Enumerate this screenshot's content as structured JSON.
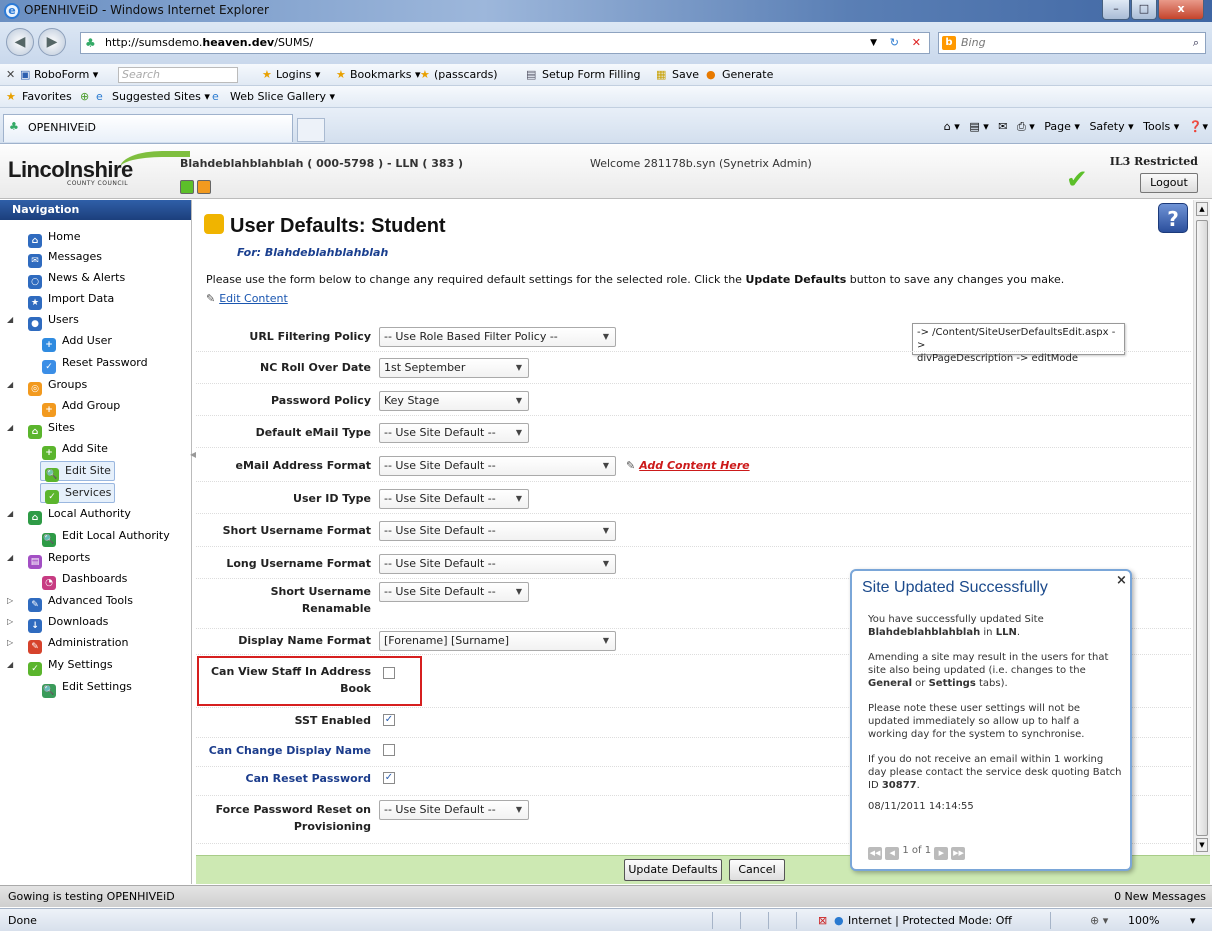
{
  "window": {
    "title": "OPENHIVEiD - Windows Internet Explorer",
    "min": "–",
    "max": "□",
    "close": "x"
  },
  "browser": {
    "url_prefix": "http://sumsdemo.",
    "url_host": "heaven.dev",
    "url_path": "/SUMS/",
    "search_placeholder": "Bing",
    "roboform": {
      "name": "RoboForm ▾",
      "search": "Search",
      "logins": "Logins ▾",
      "bookmarks": "Bookmarks ▾",
      "passcards": "(passcards)",
      "setup": "Setup Form Filling",
      "save": "Save",
      "generate": "Generate"
    },
    "favorites": {
      "label": "Favorites",
      "suggested": "Suggested Sites ▾",
      "webslice": "Web Slice Gallery ▾"
    },
    "tab_title": "OPENHIVEiD",
    "commands": [
      "Page ▾",
      "Safety ▾",
      "Tools ▾"
    ]
  },
  "header": {
    "logo": "Lincolnshire",
    "logo_sub": "COUNTY COUNCIL",
    "site_info": "Blahdeblahblahblah ( 000-5798 ) - LLN ( 383 )",
    "welcome": "Welcome 281178b.syn (Synetrix Admin)",
    "classification": "IL3 Restricted",
    "logout": "Logout"
  },
  "nav": {
    "title": "Navigation",
    "items": [
      {
        "label": "Home",
        "color": "#2f6bbf",
        "glyph": "⌂"
      },
      {
        "label": "Messages",
        "color": "#2f6bbf",
        "glyph": "✉"
      },
      {
        "label": "News & Alerts",
        "color": "#2f6bbf",
        "glyph": "○"
      },
      {
        "label": "Import Data",
        "color": "#2f6bbf",
        "glyph": "★"
      },
      {
        "label": "Users",
        "color": "#2f6bbf",
        "glyph": "●"
      },
      {
        "label": "Add User",
        "color": "#2f8be0",
        "glyph": "+"
      },
      {
        "label": "Reset Password",
        "color": "#3b8ee6",
        "glyph": "✓"
      },
      {
        "label": "Groups",
        "color": "#f29a1f",
        "glyph": "◎"
      },
      {
        "label": "Add Group",
        "color": "#f29a1f",
        "glyph": "+"
      },
      {
        "label": "Sites",
        "color": "#5bb52d",
        "glyph": "⌂"
      },
      {
        "label": "Add Site",
        "color": "#5bb52d",
        "glyph": "+"
      },
      {
        "label": "Edit Site",
        "color": "#5bb52d",
        "glyph": "🔍"
      },
      {
        "label": "Services",
        "color": "#5bb52d",
        "glyph": "✓"
      },
      {
        "label": "Local Authority",
        "color": "#2e9b46",
        "glyph": "⌂"
      },
      {
        "label": "Edit Local Authority",
        "color": "#2e9b46",
        "glyph": "🔍"
      },
      {
        "label": "Reports",
        "color": "#a34fc4",
        "glyph": "▤"
      },
      {
        "label": "Dashboards",
        "color": "#c73c82",
        "glyph": "◔"
      },
      {
        "label": "Advanced Tools",
        "color": "#2f6bbf",
        "glyph": "✎"
      },
      {
        "label": "Downloads",
        "color": "#2f6bbf",
        "glyph": "↓"
      },
      {
        "label": "Administration",
        "color": "#d6432c",
        "glyph": "✎"
      },
      {
        "label": "My Settings",
        "color": "#5bb52d",
        "glyph": "✓"
      },
      {
        "label": "Edit Settings",
        "color": "#3a9b5a",
        "glyph": "🔍"
      }
    ]
  },
  "page": {
    "title_prefix": "User Defaults: ",
    "title_role": "Student",
    "for_line": "For: Blahdeblahblahblah",
    "instr_pre": "Please use the form below to change any required default settings for the selected role. Click the ",
    "instr_bold": "Update Defaults",
    "instr_post": " button to save any changes you make.",
    "edit_content": "Edit Content",
    "add_content": "Add Content Here",
    "tooltip_line1": "-> /Content/SiteUserDefaultsEdit.aspx ->",
    "tooltip_line2": "divPageDescription -> editMode",
    "fields": {
      "url_filter": {
        "label": "URL Filtering Policy",
        "value": "-- Use Role Based Filter Policy --"
      },
      "nc_rollover": {
        "label": "NC Roll Over Date",
        "value": "1st September"
      },
      "password_policy": {
        "label": "Password Policy",
        "value": "Key Stage"
      },
      "email_type": {
        "label": "Default eMail Type",
        "value": "-- Use Site Default --"
      },
      "email_format": {
        "label": "eMail Address Format",
        "value": "-- Use Site Default --"
      },
      "userid_type": {
        "label": "User ID Type",
        "value": "-- Use Site Default --"
      },
      "short_username": {
        "label": "Short Username Format",
        "value": "-- Use Site Default --"
      },
      "long_username": {
        "label": "Long Username Format",
        "value": "-- Use Site Default --"
      },
      "short_renamable": {
        "label1": "Short Username",
        "label2": "Renamable",
        "value": "-- Use Site Default --"
      },
      "display_name": {
        "label": "Display Name Format",
        "value": "[Forename] [Surname]"
      },
      "view_staff": {
        "label1": "Can View Staff In Address",
        "label2": "Book",
        "checked": "false"
      },
      "sst": {
        "label": "SST Enabled",
        "checked": "true"
      },
      "change_display": {
        "label": "Can Change Display Name",
        "checked": "false"
      },
      "reset_password": {
        "label": "Can Reset Password",
        "checked": "true"
      },
      "force_reset": {
        "label1": "Force Password Reset on",
        "label2": "Provisioning",
        "value": "-- Use Site Default --"
      }
    },
    "update_button": "Update Defaults",
    "cancel_button": "Cancel"
  },
  "popup": {
    "title": "Site Updated Successfully",
    "close": "×",
    "p1_pre": "You have successfully updated Site ",
    "p1_site": "Blahdeblahblahblah",
    "p1_mid": " in ",
    "p1_la": "LLN",
    "p1_end": ".",
    "p2_pre": "Amending a site may result in the users for that site also being updated (i.e. changes to the ",
    "p2_general": "General",
    "p2_mid": " or ",
    "p2_settings": "Settings",
    "p2_end": " tabs).",
    "p3": "Please note these user settings will not be updated immediately so allow up to half a working day for the system to synchronise.",
    "p4_pre": "If you do not receive an email within 1 working day please contact the service desk quoting Batch ID ",
    "p4_batch": "30877",
    "p4_end": ".",
    "timestamp": "08/11/2011 14:14:55",
    "pager": "1 of 1"
  },
  "status": {
    "app_left": "Gowing is testing OPENHIVEiD",
    "app_right": "0 New Messages",
    "ie_left": "Done",
    "zone": "Internet | Protected Mode: Off",
    "zoom": "100%"
  }
}
